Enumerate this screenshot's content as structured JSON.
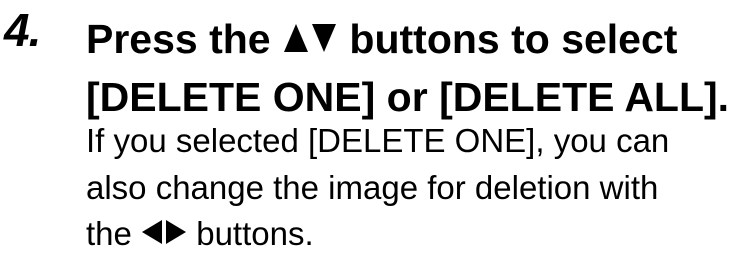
{
  "step": {
    "number": "4.",
    "heading": {
      "line1_before": "Press the",
      "line1_icon": "up-down-arrow-icon",
      "line1_after": "buttons to select",
      "line2": "[DELETE ONE] or [DELETE ALL]."
    },
    "body": {
      "line1": "If you selected [DELETE ONE], you can",
      "line2": "also change the image for deletion with",
      "line3_before": "the",
      "line3_icon": "left-right-arrow-icon",
      "line3_after": "buttons."
    }
  }
}
